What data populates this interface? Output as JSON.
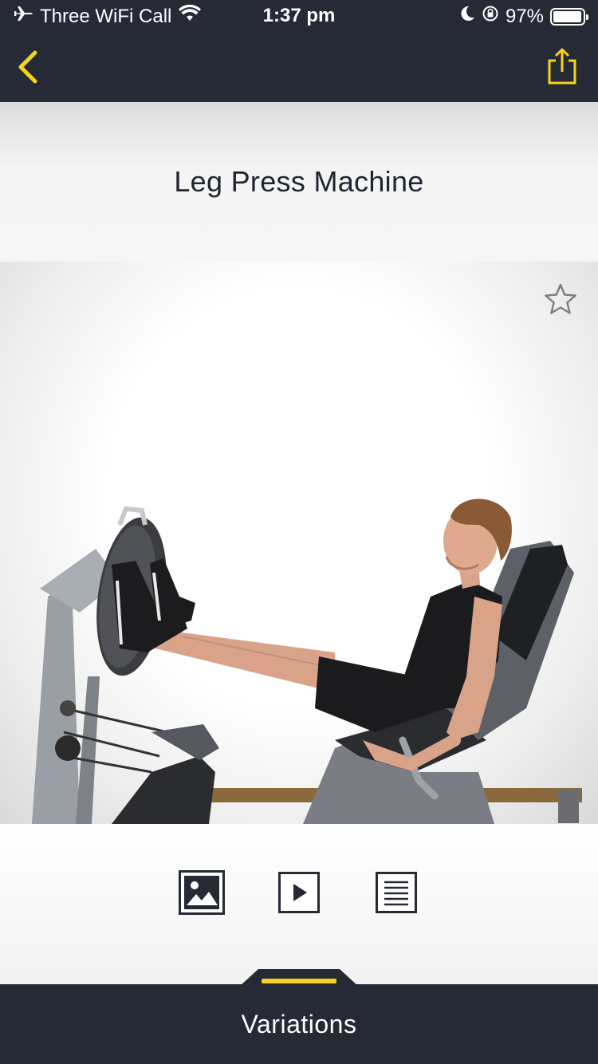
{
  "status_bar": {
    "carrier": "Three WiFi Call",
    "time": "1:37 pm",
    "battery": "97%",
    "battery_level": 0.97,
    "icons": [
      "airplane-icon",
      "wifi-icon",
      "moon-icon",
      "orientation-lock-icon",
      "battery-icon"
    ]
  },
  "nav": {
    "back_icon": "chevron-left-icon",
    "share_icon": "share-icon",
    "accent_color": "#f7d21e",
    "background_color": "#252a35"
  },
  "exercise": {
    "title": "Leg Press Machine",
    "favorite_icon": "star-outline-icon"
  },
  "media_bar": {
    "buttons": [
      {
        "icon": "image-icon",
        "selected": true
      },
      {
        "icon": "play-icon",
        "selected": false
      },
      {
        "icon": "text-document-icon",
        "selected": false
      }
    ]
  },
  "footer": {
    "variations_label": "Variations"
  }
}
